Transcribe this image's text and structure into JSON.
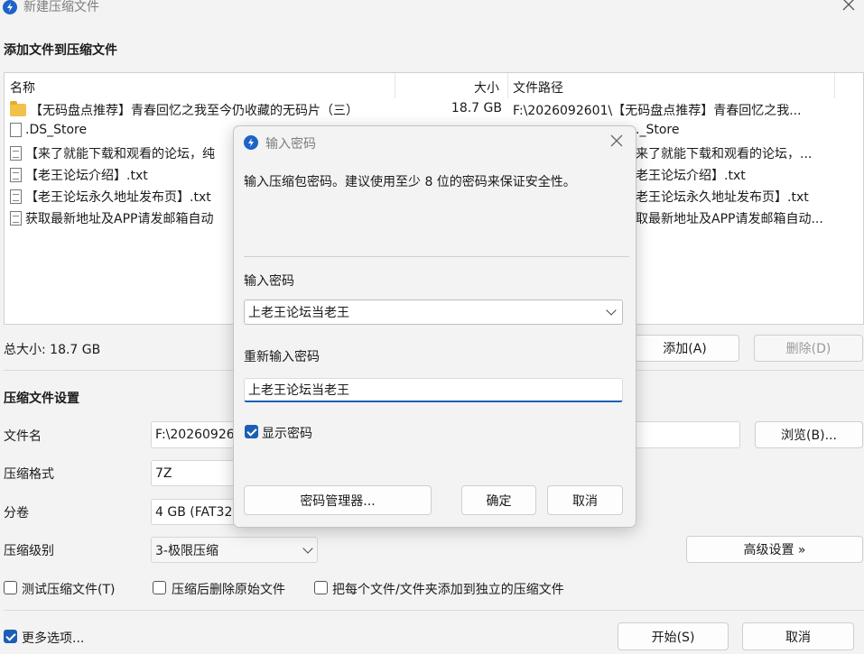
{
  "window": {
    "title": "新建压缩文件",
    "icon": "bandizip-app-icon"
  },
  "add_section": {
    "title": "添加文件到压缩文件",
    "columns": [
      "名称",
      "大小",
      "文件路径"
    ],
    "rows": [
      {
        "icon": "folder-icon",
        "name": "【无码盘点推荐】青春回忆之我至今仍收藏的无码片（三）",
        "size": "18.7 GB",
        "path": "F:\\2026092601\\【无码盘点推荐】青春回忆之我..."
      },
      {
        "icon": "file-icon",
        "name": ".DS_Store",
        "size": "",
        "path": "._Store"
      },
      {
        "icon": "text-file-icon",
        "name": "【来了就能下载和观看的论坛，纯",
        "size": "",
        "path": "来了就能下载和观看的论坛，..."
      },
      {
        "icon": "text-file-icon",
        "name": "【老王论坛介绍】.txt",
        "size": "",
        "path": "老王论坛介绍】.txt"
      },
      {
        "icon": "text-file-icon",
        "name": "【老王论坛永久地址发布页】.txt",
        "size": "",
        "path": "老王论坛永久地址发布页】.txt"
      },
      {
        "icon": "text-file-icon",
        "name": "获取最新地址及APP请发邮箱自动",
        "size": "",
        "path": "取最新地址及APP请发邮箱自动..."
      }
    ],
    "total_size": "总大小: 18.7 GB",
    "add_button": "添加(A)",
    "delete_button": "删除(D)"
  },
  "settings": {
    "title": "压缩文件设置",
    "filename_label": "文件名",
    "filename_value": "F:\\20260926",
    "browse_button": "浏览(B)...",
    "format_label": "压缩格式",
    "format_value": "7Z",
    "split_label": "分卷",
    "split_value": "4 GB (FAT32",
    "level_label": "压缩级别",
    "level_value": "3-极限压缩",
    "advanced_button": "高级设置 »",
    "test_checkbox": "测试压缩文件(T)",
    "delete_after_checkbox": "压缩后删除原始文件",
    "separate_checkbox": "把每个文件/文件夹添加到独立的压缩文件",
    "more_options_checkbox": "更多选项...",
    "start_button": "开始(S)",
    "cancel_button": "取消"
  },
  "dialog": {
    "title": "输入密码",
    "description": "输入压缩包密码。建议使用至少 8 位的密码来保证安全性。",
    "password_label": "输入密码",
    "password_value": "上老王论坛当老王",
    "reenter_label": "重新输入密码",
    "reenter_value": "上老王论坛当老王",
    "show_password_label": "显示密码",
    "show_password_checked": true,
    "manager_button": "密码管理器...",
    "ok_button": "确定",
    "cancel_button": "取消"
  },
  "colors": {
    "accent": "#1a5fb4",
    "background": "#f3f3f3",
    "input_focus_underline": "#1a5fb4"
  }
}
